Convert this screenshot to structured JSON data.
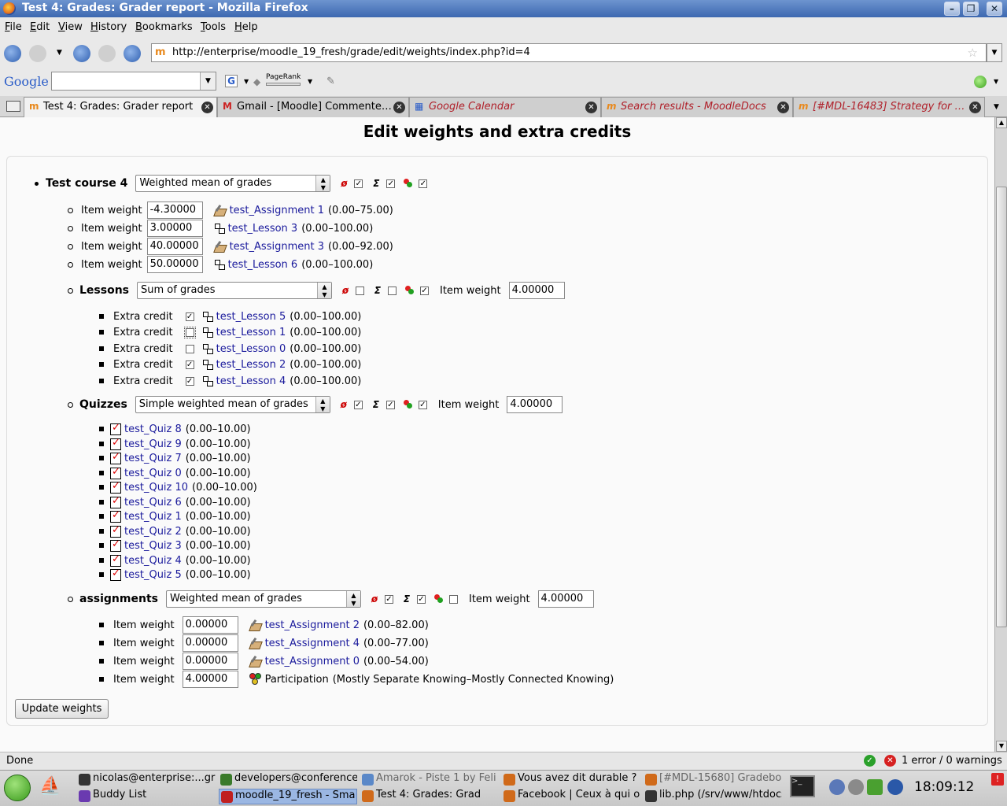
{
  "window": {
    "title": "Test 4: Grades: Grader report - Mozilla Firefox",
    "min": "–",
    "max": "❐",
    "close": "✕"
  },
  "menu": [
    "File",
    "Edit",
    "View",
    "History",
    "Bookmarks",
    "Tools",
    "Help"
  ],
  "nav": {
    "url": "http://enterprise/moodle_19_fresh/grade/edit/weights/index.php?id=4"
  },
  "google_bar": {
    "logo": "Google",
    "search_value": "",
    "pagerank_label": "PageRank"
  },
  "tabs": [
    {
      "label": "Test 4: Grades: Grader report",
      "active": true
    },
    {
      "label": "Gmail - [Moodle] Commente…",
      "active": false
    },
    {
      "label": "Google Calendar",
      "active": false
    },
    {
      "label": "Search results - MoodleDocs",
      "active": false
    },
    {
      "label": "[#MDL-16483] Strategy for …",
      "active": false
    }
  ],
  "page": {
    "title": "Edit weights and extra credits",
    "update_button": "Update weights"
  },
  "course": {
    "name": "Test course 4",
    "aggregation": "Weighted mean of grades",
    "flags": {
      "aggregate_only_graded": true,
      "aggregate_subcats": true,
      "aggregate_outcomes": true
    },
    "items": [
      {
        "label": "Item weight",
        "weight": "-4.30000",
        "name": "test_Assignment 1",
        "range": "(0.00–75.00)",
        "type": "assignment"
      },
      {
        "label": "Item weight",
        "weight": "3.00000",
        "name": "test_Lesson 3",
        "range": "(0.00–100.00)",
        "type": "lesson"
      },
      {
        "label": "Item weight",
        "weight": "40.00000",
        "name": "test_Assignment 3",
        "range": "(0.00–92.00)",
        "type": "assignment"
      },
      {
        "label": "Item weight",
        "weight": "50.00000",
        "name": "test_Lesson 6",
        "range": "(0.00–100.00)",
        "type": "lesson"
      }
    ]
  },
  "lessons": {
    "name": "Lessons",
    "aggregation": "Sum of grades",
    "flags": {
      "aggregate_only_graded": false,
      "aggregate_subcats": false,
      "aggregate_outcomes": true
    },
    "weight_label": "Item weight",
    "weight": "4.00000",
    "items": [
      {
        "label": "Extra credit",
        "checked": true,
        "name": "test_Lesson 5",
        "range": "(0.00–100.00)"
      },
      {
        "label": "Extra credit",
        "checked": false,
        "name": "test_Lesson 1",
        "range": "(0.00–100.00)"
      },
      {
        "label": "Extra credit",
        "checked": false,
        "name": "test_Lesson 0",
        "range": "(0.00–100.00)"
      },
      {
        "label": "Extra credit",
        "checked": true,
        "name": "test_Lesson 2",
        "range": "(0.00–100.00)"
      },
      {
        "label": "Extra credit",
        "checked": true,
        "name": "test_Lesson 4",
        "range": "(0.00–100.00)"
      }
    ]
  },
  "quizzes": {
    "name": "Quizzes",
    "aggregation": "Simple weighted mean of grades",
    "flags": {
      "aggregate_only_graded": true,
      "aggregate_subcats": true,
      "aggregate_outcomes": true
    },
    "weight_label": "Item weight",
    "weight": "4.00000",
    "items": [
      {
        "name": "test_Quiz 8",
        "range": "(0.00–10.00)"
      },
      {
        "name": "test_Quiz 9",
        "range": "(0.00–10.00)"
      },
      {
        "name": "test_Quiz 7",
        "range": "(0.00–10.00)"
      },
      {
        "name": "test_Quiz 0",
        "range": "(0.00–10.00)"
      },
      {
        "name": "test_Quiz 10",
        "range": "(0.00–10.00)"
      },
      {
        "name": "test_Quiz 6",
        "range": "(0.00–10.00)"
      },
      {
        "name": "test_Quiz 1",
        "range": "(0.00–10.00)"
      },
      {
        "name": "test_Quiz 2",
        "range": "(0.00–10.00)"
      },
      {
        "name": "test_Quiz 3",
        "range": "(0.00–10.00)"
      },
      {
        "name": "test_Quiz 4",
        "range": "(0.00–10.00)"
      },
      {
        "name": "test_Quiz 5",
        "range": "(0.00–10.00)"
      }
    ]
  },
  "assignments": {
    "name": "assignments",
    "aggregation": "Weighted mean of grades",
    "flags": {
      "aggregate_only_graded": true,
      "aggregate_subcats": true,
      "aggregate_outcomes": false
    },
    "weight_label": "Item weight",
    "weight": "4.00000",
    "items": [
      {
        "label": "Item weight",
        "weight": "0.00000",
        "name": "test_Assignment 2",
        "range": "(0.00–82.00)",
        "type": "assignment"
      },
      {
        "label": "Item weight",
        "weight": "0.00000",
        "name": "test_Assignment 4",
        "range": "(0.00–77.00)",
        "type": "assignment"
      },
      {
        "label": "Item weight",
        "weight": "0.00000",
        "name": "test_Assignment 0",
        "range": "(0.00–54.00)",
        "type": "assignment"
      },
      {
        "label": "Item weight",
        "weight": "4.00000",
        "name": "Participation",
        "range": "(Mostly Separate Knowing–Mostly Connected Knowing)",
        "type": "outcome"
      }
    ]
  },
  "status": {
    "text": "Done",
    "errors": "1 error / 0 warnings"
  },
  "taskbar": {
    "tasks_row1": [
      "nicolas@enterprise:...gr",
      "developers@conference",
      "Amarok - Piste 1 by Feli",
      "Vous avez dit durable ?",
      "[#MDL-15680] Gradebo"
    ],
    "tasks_row2": [
      "Buddy List",
      "moodle_19_fresh - Sma",
      "Test 4: Grades: Grad",
      "Facebook | Ceux à qui o",
      "lib.php (/srv/www/htdocs/"
    ],
    "clock": "18:09:12"
  }
}
